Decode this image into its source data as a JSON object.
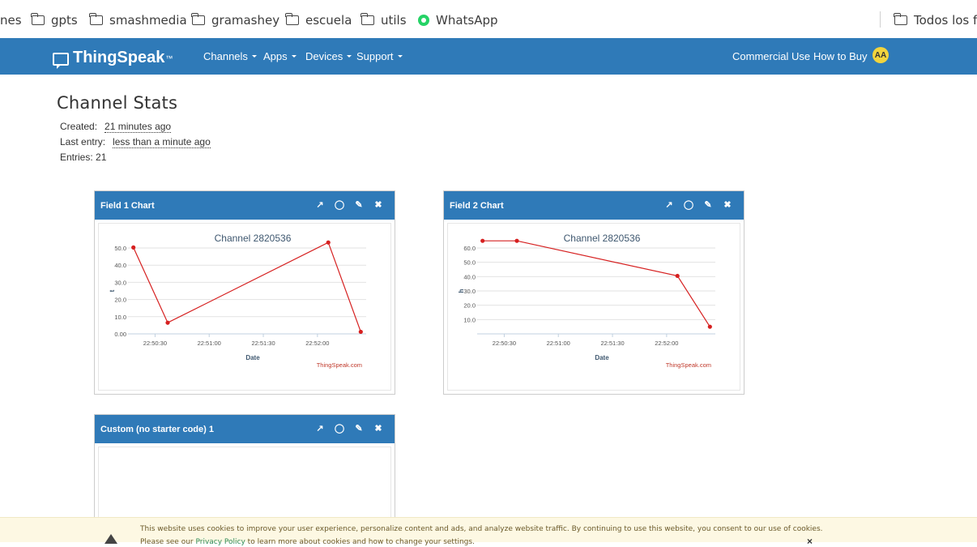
{
  "bookmarks": {
    "cut_left": "nes",
    "items": [
      {
        "label": "gpts",
        "icon": "folder-icon"
      },
      {
        "label": "smashmedia",
        "icon": "folder-icon"
      },
      {
        "label": "gramashey",
        "icon": "folder-icon"
      },
      {
        "label": "escuela",
        "icon": "folder-icon"
      },
      {
        "label": "utils",
        "icon": "folder-icon"
      },
      {
        "label": "WhatsApp",
        "icon": "whatsapp-icon"
      }
    ],
    "right_folder": "Todos los fa"
  },
  "navbar": {
    "brand": "ThingSpeak",
    "brand_tm": "™",
    "menus": [
      "Channels",
      "Apps",
      "Devices",
      "Support"
    ],
    "right_links": [
      "Commercial Use",
      "How to Buy"
    ],
    "avatar_initials": "AA",
    "color": "#2f7ab8"
  },
  "stats": {
    "title": "Channel Stats",
    "created_label": "Created:",
    "created_value": "21 minutes ago",
    "last_entry_label": "Last entry:",
    "last_entry_value": "less than a minute ago",
    "entries_label": "Entries: 21"
  },
  "panels": [
    {
      "title": "Field 1 Chart"
    },
    {
      "title": "Field 2 Chart"
    },
    {
      "title": "Custom (no starter code) 1"
    }
  ],
  "chart_data": [
    {
      "type": "line",
      "title": "Channel 2820536",
      "xlabel": "Date",
      "ylabel": "t",
      "credit": "ThingSpeak.com",
      "x_ticks": [
        "22:50:30",
        "22:51:00",
        "22:51:30",
        "22:52:00"
      ],
      "y_ticks": [
        "0.00",
        "10.0",
        "20.0",
        "30.0",
        "40.0",
        "50.0"
      ],
      "ylim": [
        0,
        50
      ],
      "series": [
        {
          "values": [
            {
              "x": "22:50:18",
              "y": 50.3
            },
            {
              "x": "22:50:37",
              "y": 6.5
            },
            {
              "x": "22:52:06",
              "y": 53.2
            },
            {
              "x": "22:52:24",
              "y": 1.2
            }
          ],
          "color": "#d62020"
        }
      ]
    },
    {
      "type": "line",
      "title": "Channel 2820536",
      "xlabel": "Date",
      "ylabel": "h",
      "credit": "ThingSpeak.com",
      "x_ticks": [
        "22:50:30",
        "22:51:00",
        "22:51:30",
        "22:52:00"
      ],
      "y_ticks": [
        "10.0",
        "20.0",
        "30.0",
        "40.0",
        "50.0",
        "60.0"
      ],
      "ylim": [
        0,
        60
      ],
      "series": [
        {
          "values": [
            {
              "x": "22:50:18",
              "y": 65.0
            },
            {
              "x": "22:50:37",
              "y": 65.0
            },
            {
              "x": "22:52:06",
              "y": 40.5
            },
            {
              "x": "22:52:24",
              "y": 5.0
            }
          ],
          "color": "#d62020"
        }
      ]
    }
  ],
  "cookie": {
    "text": "This website uses cookies to improve your user experience, personalize content and ads, and analyze website traffic. By continuing to use this website, you consent to our use of cookies.",
    "text2_before": "Please see our ",
    "text2_link": "Privacy Policy",
    "text2_after": " to learn more about cookies and how to change your settings.",
    "close_symbol": "×"
  }
}
